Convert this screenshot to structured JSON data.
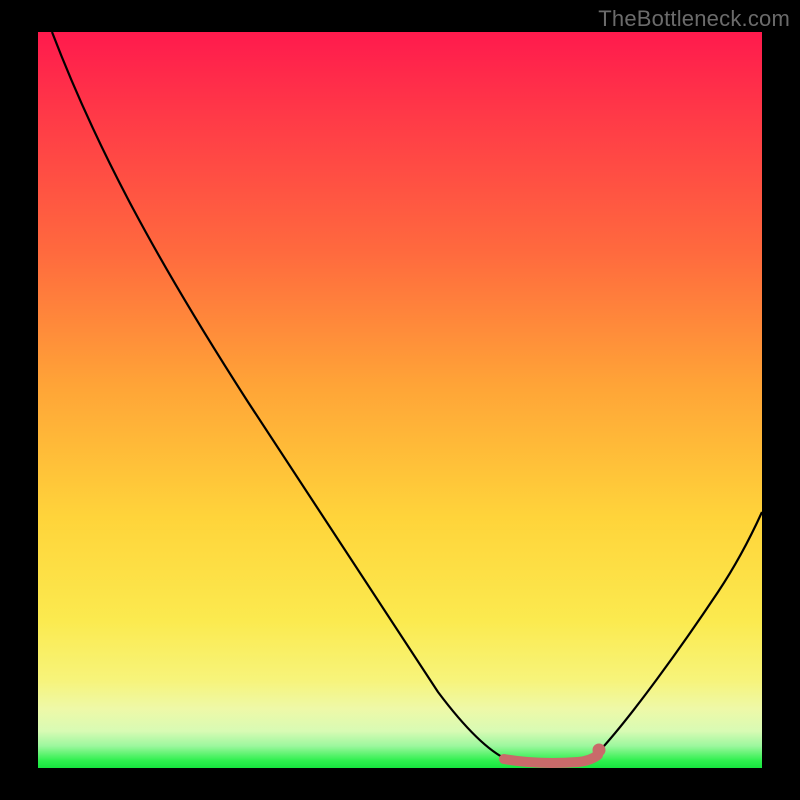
{
  "watermark": "TheBottleneck.com",
  "chart_data": {
    "type": "line",
    "title": "",
    "xlabel": "",
    "ylabel": "",
    "xlim": [
      0,
      100
    ],
    "ylim": [
      0,
      100
    ],
    "background_gradient": {
      "stops": [
        {
          "pos": 0,
          "color": "#ff1a4d"
        },
        {
          "pos": 30,
          "color": "#ff6a3e"
        },
        {
          "pos": 66,
          "color": "#ffd43a"
        },
        {
          "pos": 88,
          "color": "#f7f47a"
        },
        {
          "pos": 97,
          "color": "#9cf79e"
        },
        {
          "pos": 100,
          "color": "#16e53e"
        }
      ]
    },
    "curve": {
      "description": "V-shaped bottleneck curve; minimum near x≈70% with flat bottom; left branch reaches top at x≈2%, right branch rises to ~42% height at right edge",
      "points": [
        {
          "x": 2,
          "y": 100
        },
        {
          "x": 15,
          "y": 79
        },
        {
          "x": 30,
          "y": 55
        },
        {
          "x": 45,
          "y": 32
        },
        {
          "x": 55,
          "y": 17
        },
        {
          "x": 62,
          "y": 6
        },
        {
          "x": 65,
          "y": 2
        },
        {
          "x": 67,
          "y": 0.5
        },
        {
          "x": 75,
          "y": 0.5
        },
        {
          "x": 77,
          "y": 2
        },
        {
          "x": 82,
          "y": 8
        },
        {
          "x": 90,
          "y": 22
        },
        {
          "x": 100,
          "y": 42
        }
      ]
    },
    "flat_marker": {
      "color": "#c96a6a",
      "x_start": 64,
      "x_end": 77,
      "y": 1.2,
      "dot_x": 77,
      "dot_y": 2.0
    }
  }
}
